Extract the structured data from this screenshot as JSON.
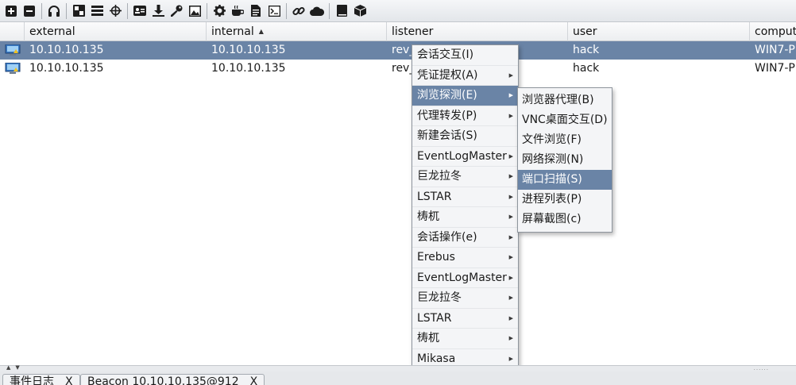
{
  "toolbar": {
    "buttons": [
      {
        "icon": "plus-square-icon"
      },
      {
        "icon": "minus-square-icon"
      },
      {
        "icon": "headphones-icon"
      },
      {
        "icon": "graph-icon"
      },
      {
        "icon": "list-icon"
      },
      {
        "icon": "crosshair-icon"
      },
      {
        "icon": "credentials-icon"
      },
      {
        "icon": "download-icon"
      },
      {
        "icon": "key-icon"
      },
      {
        "icon": "image-icon"
      },
      {
        "icon": "gear-icon"
      },
      {
        "icon": "coffee-icon"
      },
      {
        "icon": "document-icon"
      },
      {
        "icon": "terminal-icon"
      },
      {
        "icon": "link-icon"
      },
      {
        "icon": "cloud-icon"
      },
      {
        "icon": "book-icon"
      },
      {
        "icon": "cube-icon"
      }
    ]
  },
  "table": {
    "columns": [
      "external",
      "internal",
      "listener",
      "user",
      "comput"
    ],
    "sorted_column": "internal",
    "sort_direction": "ascending",
    "rows": [
      {
        "external": "10.10.10.135",
        "internal": "10.10.10.135",
        "listener": "rev_",
        "user": "hack",
        "computer": "WIN7-P",
        "selected": true
      },
      {
        "external": "10.10.10.135",
        "internal": "10.10.10.135",
        "listener": "rev_",
        "user": "hack",
        "computer": "WIN7-P",
        "selected": false
      }
    ]
  },
  "context_menu": {
    "items": [
      {
        "label": "会话交互(I)",
        "submenu": false
      },
      {
        "label": "凭证提权(A)",
        "submenu": true
      },
      {
        "label": "浏览探测(E)",
        "submenu": true,
        "highlighted": true
      },
      {
        "label": "代理转发(P)",
        "submenu": true
      },
      {
        "label": "新建会话(S)",
        "submenu": false
      },
      {
        "label": "EventLogMaster",
        "submenu": true
      },
      {
        "label": "巨龙拉冬",
        "submenu": true
      },
      {
        "label": "LSTAR",
        "submenu": true
      },
      {
        "label": "梼杌",
        "submenu": true
      },
      {
        "label": "会话操作(e)",
        "submenu": true
      },
      {
        "label": "Erebus",
        "submenu": true
      },
      {
        "label": "EventLogMaster",
        "submenu": true
      },
      {
        "label": "巨龙拉冬",
        "submenu": true
      },
      {
        "label": "LSTAR",
        "submenu": true
      },
      {
        "label": "梼杌",
        "submenu": true
      },
      {
        "label": "Mikasa",
        "submenu": true
      }
    ]
  },
  "submenu": {
    "items": [
      {
        "label": "浏览器代理(B)"
      },
      {
        "label": "VNC桌面交互(D)"
      },
      {
        "label": "文件浏览(F)"
      },
      {
        "label": "网络探测(N)"
      },
      {
        "label": "端口扫描(S)",
        "highlighted": true
      },
      {
        "label": "进程列表(P)"
      },
      {
        "label": "屏幕截图(c)"
      }
    ]
  },
  "tabs": [
    {
      "label": "事件日志",
      "close": "X"
    },
    {
      "label": "Beacon 10.10.10.135@912",
      "close": "X"
    }
  ],
  "colors": {
    "selection": "#6a84a6",
    "menu_background": "#f4f5f7"
  }
}
